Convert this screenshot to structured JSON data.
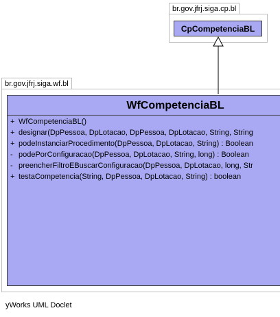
{
  "packages": {
    "cp": {
      "name": "br.gov.jfrj.siga.cp.bl"
    },
    "wf": {
      "name": "br.gov.jfrj.siga.wf.bl"
    }
  },
  "classes": {
    "parent": {
      "name": "CpCompetenciaBL"
    },
    "main": {
      "name": "WfCompetenciaBL",
      "operations": [
        {
          "visibility": "+",
          "signature": "WfCompetenciaBL()"
        },
        {
          "visibility": "+",
          "signature": "designar(DpPessoa, DpLotacao, DpPessoa, DpLotacao, String, String"
        },
        {
          "visibility": "+",
          "signature": "podeInstanciarProcedimento(DpPessoa, DpLotacao, String) : Boolean"
        },
        {
          "visibility": "-",
          "signature": "podePorConfiguracao(DpPessoa, DpLotacao, String, long) : Boolean"
        },
        {
          "visibility": "-",
          "signature": "preencherFiltroEBuscarConfiguracao(DpPessoa, DpLotacao, long, Str"
        },
        {
          "visibility": "+",
          "signature": "testaCompetencia(String, DpPessoa, DpLotacao, String) : boolean"
        }
      ]
    }
  },
  "relations": [
    {
      "type": "generalization",
      "from": "WfCompetenciaBL",
      "to": "CpCompetenciaBL"
    }
  ],
  "footer": {
    "text": "yWorks UML Doclet"
  },
  "colors": {
    "class_fill": "#a9a9f3",
    "border": "#3a3a3a",
    "package_border": "#bdbdbd"
  }
}
